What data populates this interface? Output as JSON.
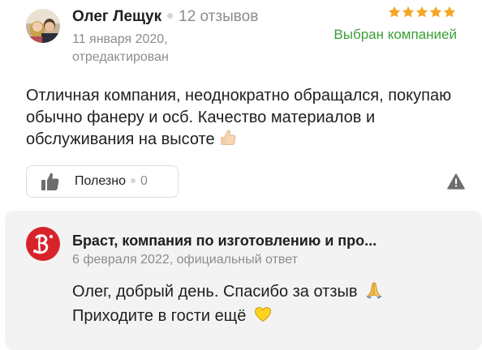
{
  "review": {
    "author_name": "Олег Лещук",
    "review_count": "12 отзывов",
    "date": "11 января 2020,",
    "edited_label": "отредактирован",
    "rating": 5,
    "company_choice_label": "Выбран компанией",
    "text": "Отличная компания, неоднократно обращался, покупаю обычно фанеру и осб. Качество материалов и обслуживания на высоте",
    "useful_button": {
      "label": "Полезно",
      "count": "0"
    },
    "icons": {
      "thumbs_up_emoji": "thumbs-up-emoji-icon",
      "like": "thumbs-up-icon",
      "report": "warning-icon"
    }
  },
  "company_answer": {
    "company_name": "Браст, компания по изготовлению и про...",
    "meta": "6 февраля 2022, официальный ответ",
    "line1": "Олег, добрый день. Спасибо за отзыв",
    "line2": "Приходите в гости ещё",
    "icons": {
      "pray_emoji": "folded-hands-emoji-icon",
      "heart_emoji": "yellow-heart-emoji-icon",
      "logo": "company-logo-icon"
    }
  },
  "colors": {
    "star": "#f5a623",
    "company_choice": "#3a9e34",
    "secondary_text": "#8c8c8c",
    "answer_background": "#f3f3f3",
    "logo_red": "#d8232a"
  }
}
